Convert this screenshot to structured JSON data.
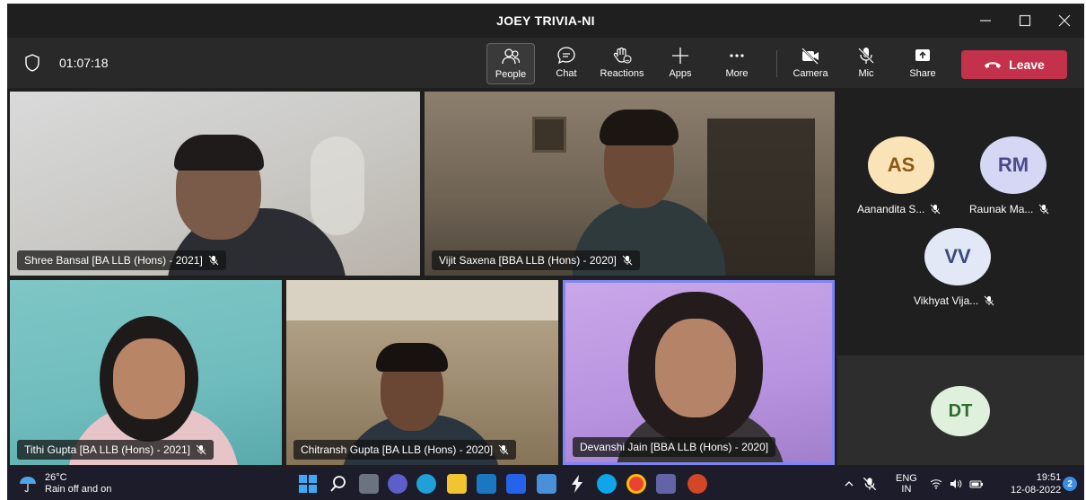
{
  "window": {
    "title": "JOEY TRIVIA-NI"
  },
  "toolbar": {
    "timer": "01:07:18",
    "tools": {
      "people": "People",
      "chat": "Chat",
      "reactions": "Reactions",
      "apps": "Apps",
      "more": "More",
      "camera": "Camera",
      "mic": "Mic",
      "share": "Share"
    },
    "leave": "Leave"
  },
  "participants": {
    "tile1": "Shree Bansal [BA LLB (Hons) - 2021]",
    "tile2": "Vijit Saxena [BBA LLB (Hons) - 2020]",
    "tile3": "Tithi Gupta [BA LLB (Hons) - 2021]",
    "tile4": "Chitransh Gupta [BA LLB (Hons) - 2020]",
    "tile5": "Devanshi Jain [BBA LLB (Hons) - 2020]"
  },
  "roster": [
    {
      "initials": "AS",
      "name": "Aanandita S..."
    },
    {
      "initials": "RM",
      "name": "Raunak Ma..."
    },
    {
      "initials": "VV",
      "name": "Vikhyat Vija..."
    }
  ],
  "dt_tile": {
    "initials": "DT"
  },
  "taskbar": {
    "weather_temp": "26°C",
    "weather_desc": "Rain off and on",
    "lang_top": "ENG",
    "lang_bottom": "IN",
    "time": "19:51",
    "date": "12-08-2022",
    "notifications": "2"
  },
  "colors": {
    "leave": "#c4314b",
    "active_speaker": "#7f85f5",
    "avatar_as": "#fbe3b8",
    "avatar_rm": "#d6d6f5",
    "avatar_vv": "#e2e8f5",
    "avatar_dt": "#dff0dd"
  }
}
